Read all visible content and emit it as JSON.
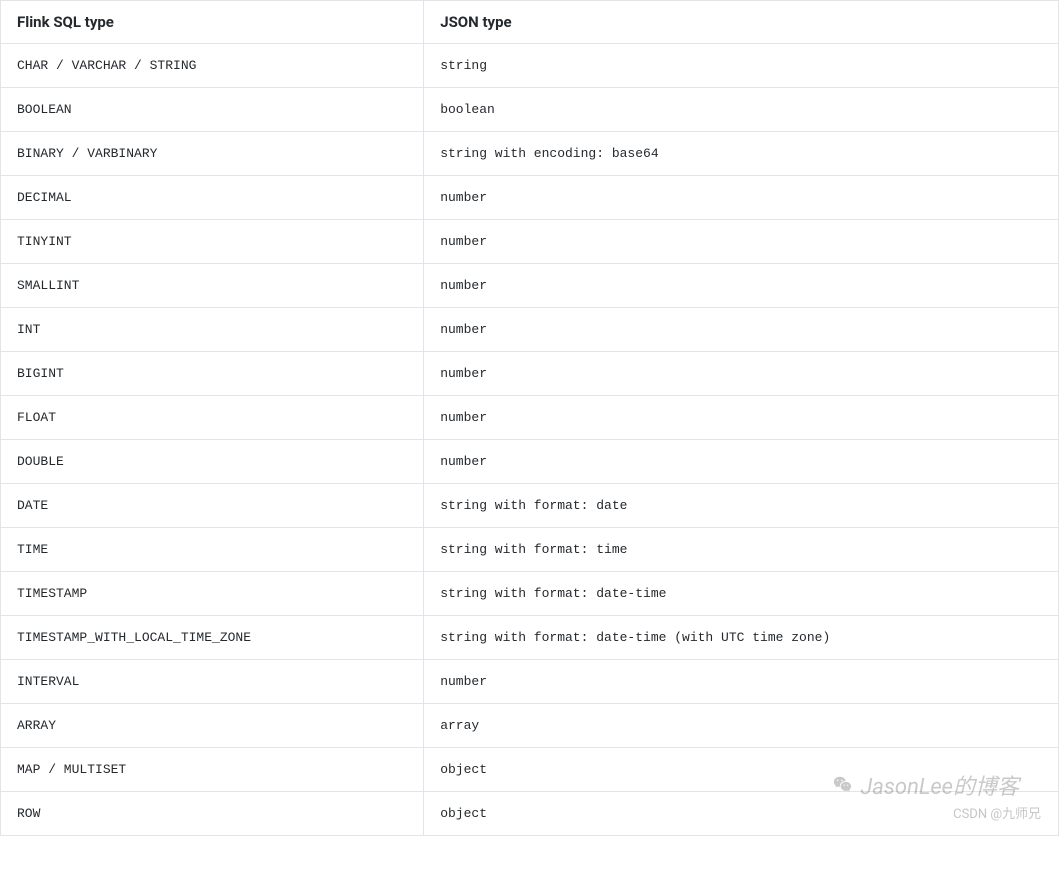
{
  "table": {
    "headers": {
      "col1": "Flink SQL type",
      "col2": "JSON type"
    },
    "rows": [
      {
        "flink": "CHAR / VARCHAR / STRING",
        "json": "string"
      },
      {
        "flink": "BOOLEAN",
        "json": "boolean"
      },
      {
        "flink": "BINARY / VARBINARY",
        "json": "string with encoding: base64"
      },
      {
        "flink": "DECIMAL",
        "json": "number"
      },
      {
        "flink": "TINYINT",
        "json": "number"
      },
      {
        "flink": "SMALLINT",
        "json": "number"
      },
      {
        "flink": "INT",
        "json": "number"
      },
      {
        "flink": "BIGINT",
        "json": "number"
      },
      {
        "flink": "FLOAT",
        "json": "number"
      },
      {
        "flink": "DOUBLE",
        "json": "number"
      },
      {
        "flink": "DATE",
        "json": "string with format: date"
      },
      {
        "flink": "TIME",
        "json": "string with format: time"
      },
      {
        "flink": "TIMESTAMP",
        "json": "string with format: date-time"
      },
      {
        "flink": "TIMESTAMP_WITH_LOCAL_TIME_ZONE",
        "json": "string with format: date-time (with UTC time zone)"
      },
      {
        "flink": "INTERVAL",
        "json": "number"
      },
      {
        "flink": "ARRAY",
        "json": "array"
      },
      {
        "flink": "MAP / MULTISET",
        "json": "object"
      },
      {
        "flink": "ROW",
        "json": "object"
      }
    ]
  },
  "watermark": {
    "main": "JasonLee的博客",
    "sub": "CSDN @九师兄"
  }
}
